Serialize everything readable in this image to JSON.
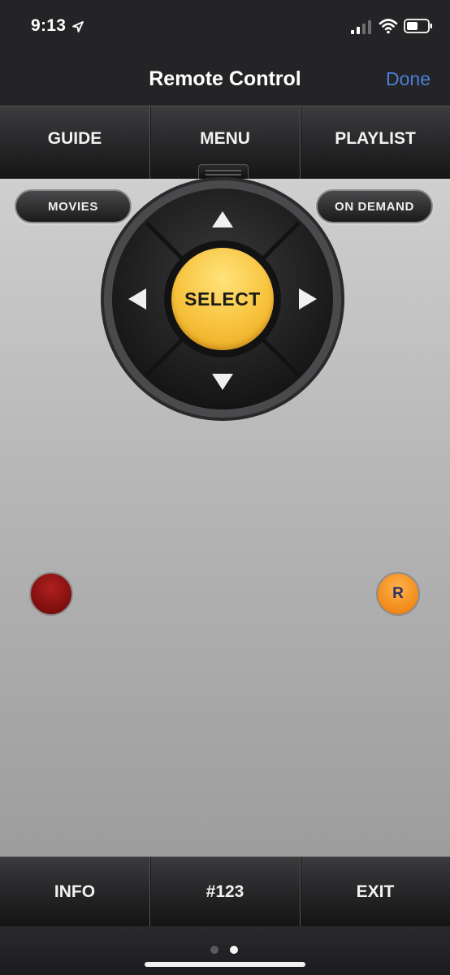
{
  "status_bar": {
    "time": "9:13",
    "icons": [
      "location-arrow-icon",
      "cellular-signal-icon",
      "wifi-icon",
      "battery-icon"
    ]
  },
  "nav": {
    "title": "Remote Control",
    "done_label": "Done",
    "done_color": "#4a7fd6"
  },
  "top_tabs": [
    "GUIDE",
    "MENU",
    "PLAYLIST"
  ],
  "remote": {
    "movies_label": "MOVIES",
    "on_demand_label": "ON DEMAND",
    "select_label": "SELECT",
    "select_color": "#f7c23c",
    "dpad_icons": [
      "arrow-up-icon",
      "arrow-down-icon",
      "arrow-left-icon",
      "arrow-right-icon"
    ],
    "record_color": "#8b1010",
    "r_label": "R",
    "r_color": "#f08a1a"
  },
  "bottom_tabs": [
    "INFO",
    "#123",
    "EXIT"
  ],
  "page_indicator": {
    "count": 2,
    "active": 2
  }
}
